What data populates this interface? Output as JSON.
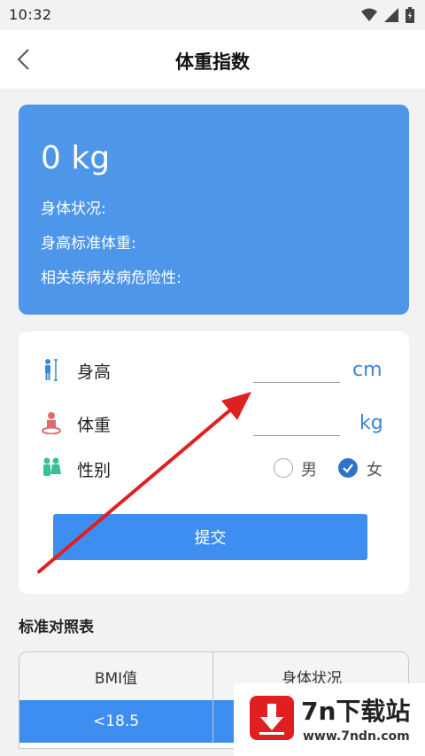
{
  "status_bar": {
    "time": "10:32",
    "icons": [
      "wifi-icon",
      "signal-icon",
      "battery-icon"
    ]
  },
  "header": {
    "title": "体重指数",
    "back_icon": "back-chevron-icon"
  },
  "result": {
    "weight": "0 kg",
    "body_status_label": "身体状况:",
    "standard_weight_label": "身高标准体重:",
    "disease_risk_label": "相关疾病发病危险性:"
  },
  "form": {
    "height": {
      "label": "身高",
      "value": "",
      "unit": "cm",
      "icon": "height-icon"
    },
    "weight": {
      "label": "体重",
      "value": "",
      "unit": "kg",
      "icon": "weight-icon"
    },
    "gender": {
      "label": "性别",
      "icon": "gender-icon",
      "options": [
        "男",
        "女"
      ],
      "selected": "女"
    },
    "submit_label": "提交"
  },
  "reference_table": {
    "title": "标准对照表",
    "headers": [
      "BMI值",
      "身体状况"
    ],
    "rows": [
      [
        "<18.5",
        ""
      ]
    ]
  },
  "watermark": {
    "title": "7n下载站",
    "url": "www.7ndn.com"
  },
  "colors": {
    "accent": "#4d96ea",
    "button": "#3d8ef0",
    "unit_text": "#3a86d8",
    "selected_radio": "#2f73c8",
    "annotation_arrow": "#e02020"
  }
}
